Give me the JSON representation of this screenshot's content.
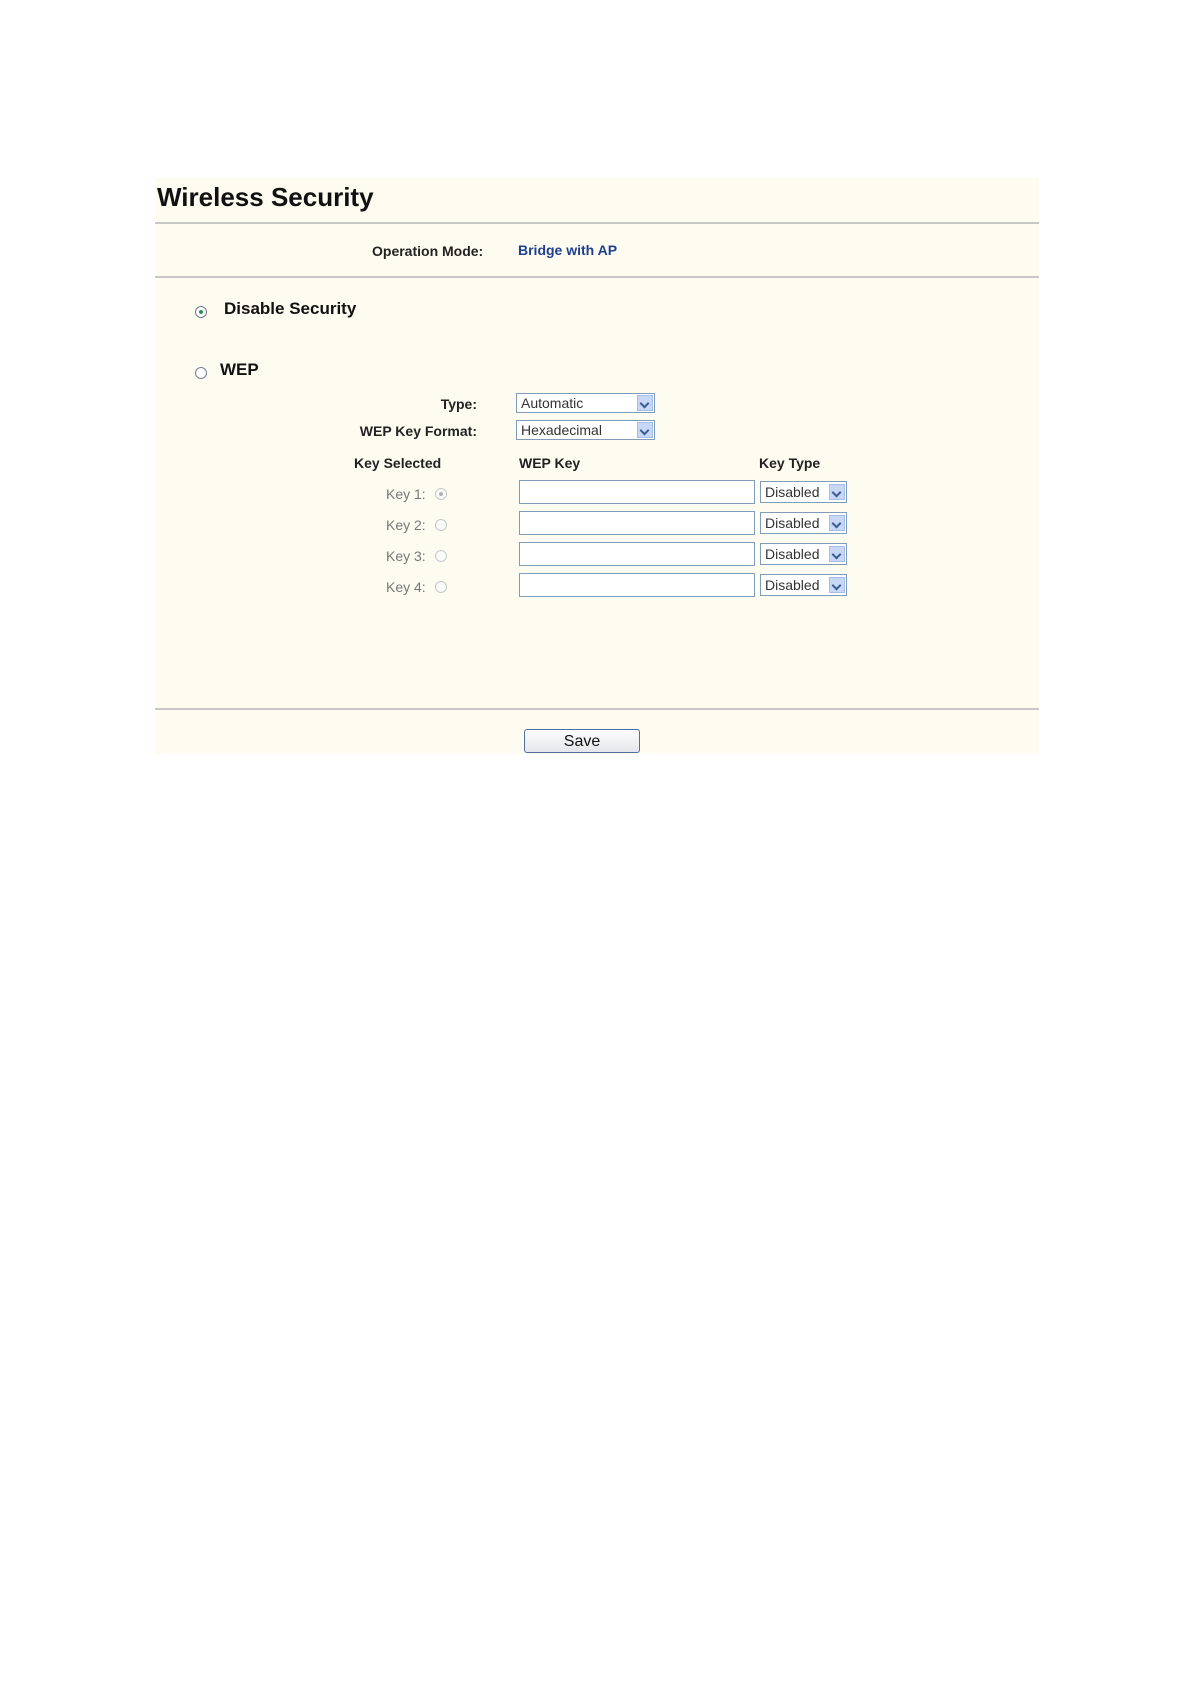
{
  "page": {
    "title": "Wireless Security"
  },
  "operation_mode": {
    "label": "Operation Mode:",
    "value": "Bridge with AP"
  },
  "security_options": {
    "disable_security": {
      "label": "Disable Security",
      "checked": true
    },
    "wep": {
      "label": "WEP",
      "checked": false
    }
  },
  "wep_settings": {
    "type_label": "Type:",
    "type_value": "Automatic",
    "key_format_label": "WEP Key Format:",
    "key_format_value": "Hexadecimal",
    "headers": {
      "key_selected": "Key Selected",
      "wep_key": "WEP Key",
      "key_type": "Key Type"
    },
    "keys": [
      {
        "label": "Key 1:",
        "selected": true,
        "value": "",
        "key_type": "Disabled"
      },
      {
        "label": "Key 2:",
        "selected": false,
        "value": "",
        "key_type": "Disabled"
      },
      {
        "label": "Key 3:",
        "selected": false,
        "value": "",
        "key_type": "Disabled"
      },
      {
        "label": "Key 4:",
        "selected": false,
        "value": "",
        "key_type": "Disabled"
      }
    ]
  },
  "actions": {
    "save_label": "Save"
  },
  "colors": {
    "panel_background": "#fefcf0",
    "operation_mode_value": "#1f3f8f",
    "checked_radio_dot": "#2f8f4f"
  }
}
